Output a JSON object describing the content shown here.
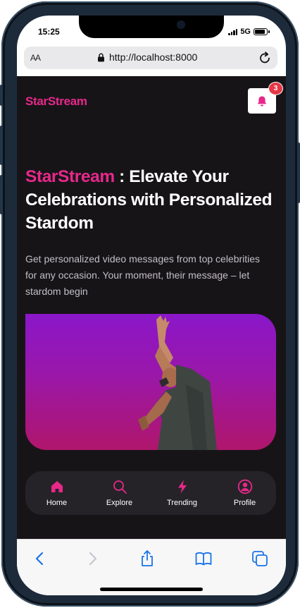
{
  "status": {
    "time": "15:25",
    "network": "5G"
  },
  "browser": {
    "text_size_label": "AA",
    "url": "http://localhost:8000"
  },
  "header": {
    "brand": "StarStream",
    "notification_count": "3"
  },
  "hero": {
    "brand": "StarStream",
    "headline": " : Elevate Your Celebrations with Personalized Stardom",
    "description": "Get personalized video messages from top celebrities for any occasion. Your moment, their message – let stardom begin"
  },
  "nav": {
    "items": [
      {
        "label": "Home",
        "icon": "home-icon"
      },
      {
        "label": "Explore",
        "icon": "search-icon"
      },
      {
        "label": "Trending",
        "icon": "lightning-icon"
      },
      {
        "label": "Profile",
        "icon": "user-circle-icon"
      }
    ]
  },
  "colors": {
    "accent": "#e7288a",
    "background": "#171418",
    "nav_background": "#262328",
    "badge": "#e63746",
    "toolbar_icons": "#1a73e8"
  }
}
